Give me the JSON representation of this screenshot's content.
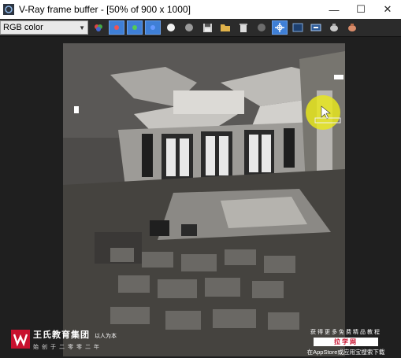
{
  "window": {
    "title": "V-Ray frame buffer - [50% of 900 x 1000]",
    "minimize_glyph": "—",
    "maximize_glyph": "☐",
    "close_glyph": "✕"
  },
  "toolbar": {
    "channel_value": "RGB color",
    "buttons": [
      {
        "name": "color-balls-icon"
      },
      {
        "name": "red-channel-icon",
        "active": true
      },
      {
        "name": "green-channel-icon",
        "active": true
      },
      {
        "name": "blue-channel-icon",
        "active": true
      },
      {
        "name": "white-sphere-icon"
      },
      {
        "name": "gray-sphere-icon"
      },
      {
        "name": "save-icon"
      },
      {
        "name": "folder-icon"
      },
      {
        "name": "clear-icon"
      },
      {
        "name": "dark-sphere-icon"
      },
      {
        "name": "track-mouse-icon",
        "active": true
      },
      {
        "name": "region-render-icon"
      },
      {
        "name": "link-icon"
      },
      {
        "name": "teapot-icon"
      },
      {
        "name": "stop-render-icon"
      }
    ]
  },
  "colors": {
    "titlebar_bg": "#ffffff",
    "toolbar_bg": "#2b2b2b",
    "viewport_bg": "#1f1f1f",
    "active_button": "#3f7fd6",
    "cursor_highlight": "#e6e61e",
    "brand_red": "#c8102e"
  },
  "watermark_left": {
    "name": "王氏教育集团",
    "motto": "以人为本",
    "sub": "始创于二零零二年"
  },
  "watermark_right": {
    "line1": "获得更多免费精品教程",
    "brand": "拉学网",
    "line3": "在AppStore或应用宝搜索下载"
  }
}
